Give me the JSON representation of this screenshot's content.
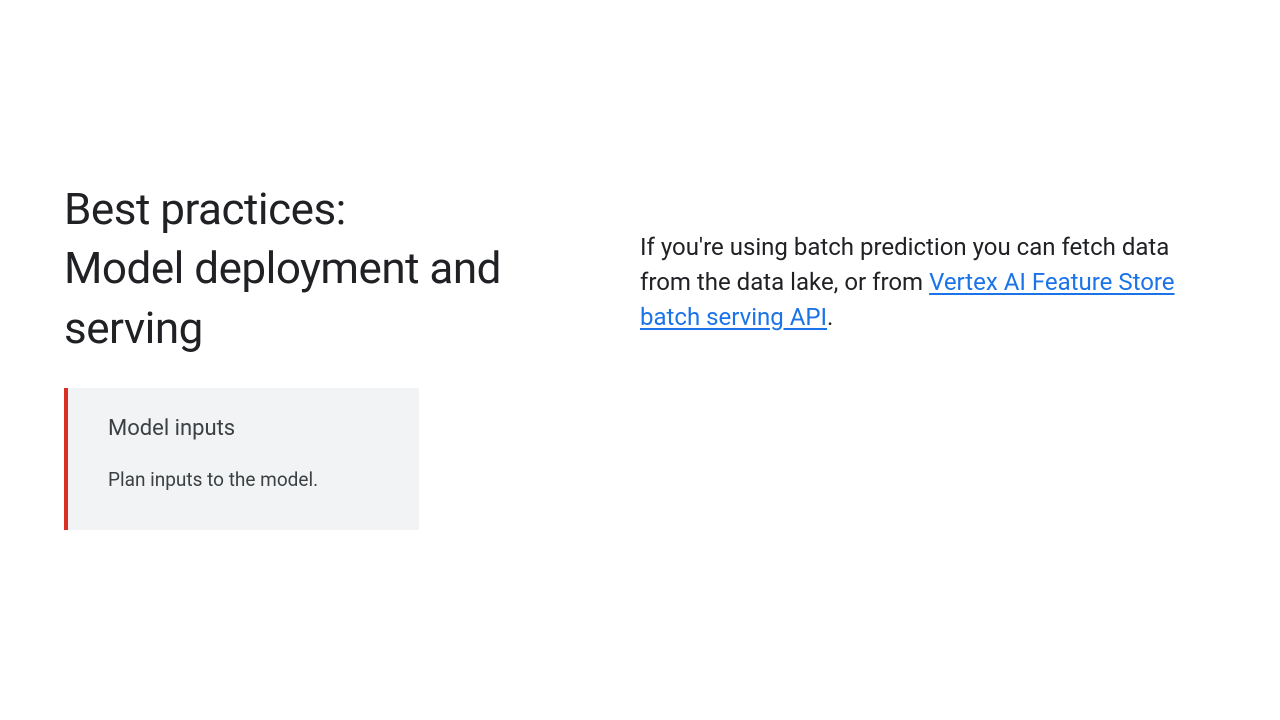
{
  "left": {
    "title_line1": "Best practices:",
    "title_line2": "Model deployment and serving",
    "card": {
      "heading": "Model inputs",
      "description": "Plan inputs to the model."
    }
  },
  "right": {
    "text_before_link": "If you're using batch prediction you can fetch data from the data lake, or from ",
    "link_text": "Vertex AI Feature Store batch serving API",
    "text_after_link": "."
  }
}
